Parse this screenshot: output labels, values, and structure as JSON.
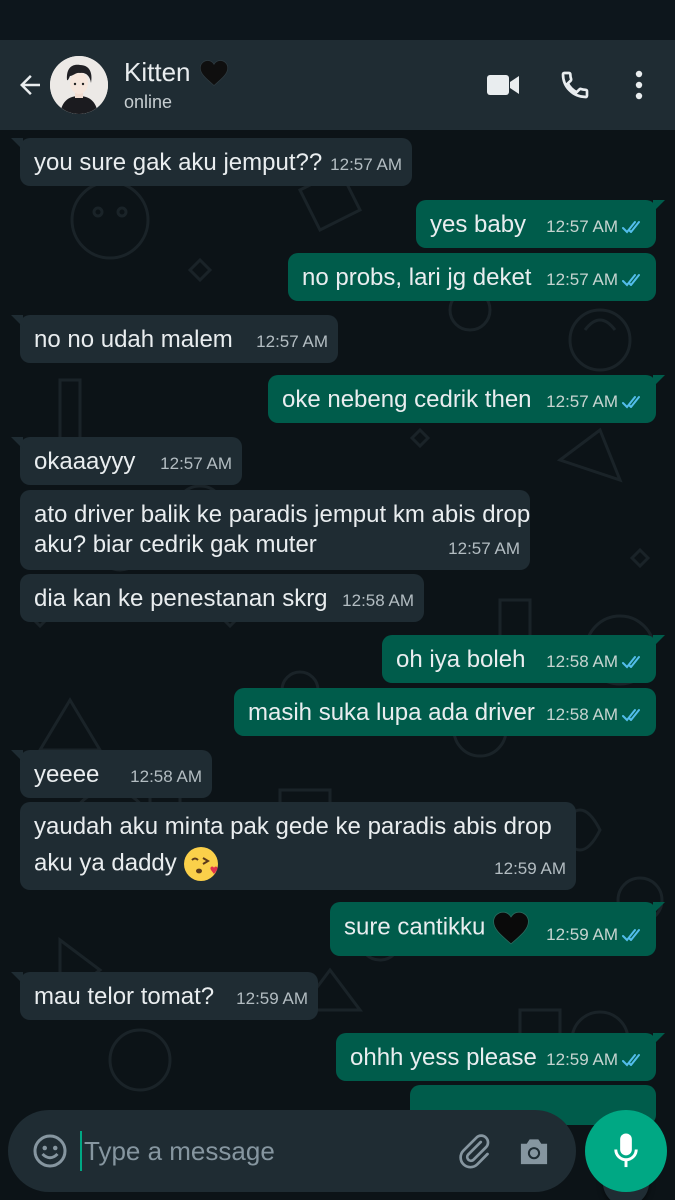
{
  "header": {
    "contact_name": "Kitten",
    "contact_status": "online"
  },
  "messages": [
    {
      "dir": "in",
      "text": "you sure gak aku jemput??",
      "time": "12:57 AM"
    },
    {
      "dir": "out",
      "text": "yes baby",
      "time": "12:57 AM"
    },
    {
      "dir": "out",
      "text": "no probs, lari jg deket",
      "time": "12:57 AM"
    },
    {
      "dir": "in",
      "text": "no no udah malem",
      "time": "12:57 AM"
    },
    {
      "dir": "out",
      "text": "oke nebeng cedrik then",
      "time": "12:57 AM"
    },
    {
      "dir": "in",
      "text": "okaaayyy",
      "time": "12:57 AM"
    },
    {
      "dir": "in",
      "text_line1": "ato driver balik ke paradis jemput km abis drop",
      "text_line2": "aku? biar cedrik gak muter",
      "time": "12:57 AM"
    },
    {
      "dir": "in",
      "text": "dia kan ke penestanan skrg",
      "time": "12:58 AM"
    },
    {
      "dir": "out",
      "text": "oh iya boleh",
      "time": "12:58 AM"
    },
    {
      "dir": "out",
      "text": "masih suka lupa ada driver",
      "time": "12:58 AM"
    },
    {
      "dir": "in",
      "text": "yeeee",
      "time": "12:58 AM"
    },
    {
      "dir": "in",
      "text_line1": "yaudah aku minta pak gede ke paradis abis drop",
      "text_line2": "aku ya daddy",
      "time": "12:59 AM"
    },
    {
      "dir": "out",
      "text": "sure cantikku",
      "time": "12:59 AM"
    },
    {
      "dir": "in",
      "text": "mau telor tomat?",
      "time": "12:59 AM"
    },
    {
      "dir": "out",
      "text": "ohhh yess please",
      "time": "12:59 AM"
    }
  ],
  "input": {
    "placeholder": "Type a message"
  },
  "colors": {
    "header_bg": "#1f2c33",
    "incoming_bubble": "#1f2c33",
    "outgoing_bubble": "#005c4b",
    "accent": "#00a884",
    "read_ticks": "#53bdeb"
  },
  "icons": [
    "back-arrow-icon",
    "black-heart-emoji",
    "video-call-icon",
    "phone-icon",
    "more-options-icon",
    "double-check-icon",
    "kissing-heart-emoji",
    "chevron-down-icon",
    "emoji-icon",
    "attach-icon",
    "camera-icon",
    "mic-icon"
  ]
}
